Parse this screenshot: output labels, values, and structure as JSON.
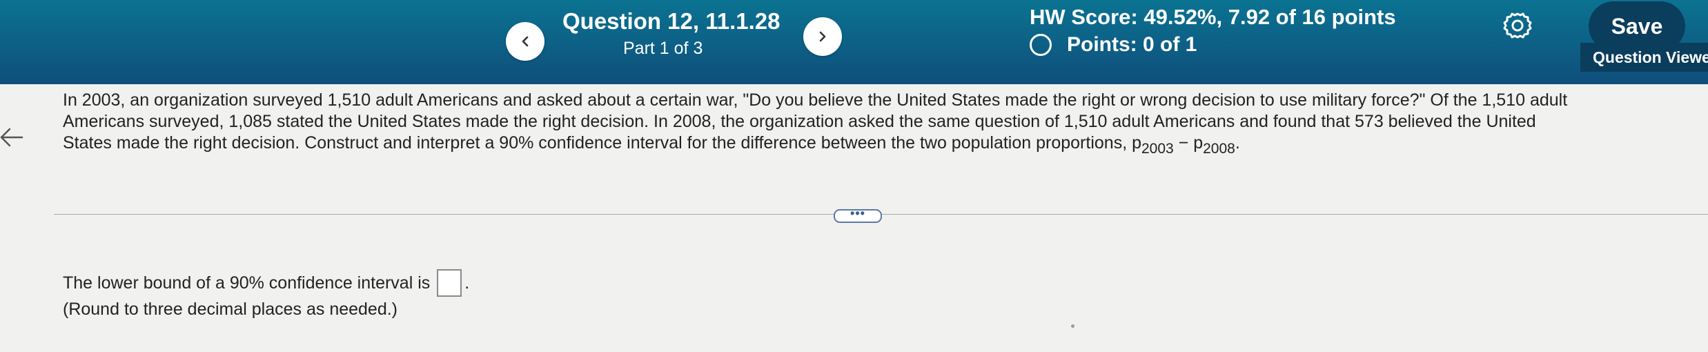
{
  "header": {
    "question_title": "Question 12, 11.1.28",
    "part": "Part 1 of 3",
    "hw_score": "HW Score: 49.52%, 7.92 of 16 points",
    "points": "Points: 0 of 1",
    "save_label": "Save",
    "question_viewer_label": "Question Viewer",
    "icons": {
      "prev": "chevron-left-icon",
      "next": "chevron-right-icon",
      "settings": "gear-icon",
      "points_status": "empty-circle-icon"
    },
    "colors": {
      "header_top": "#0b7391",
      "header_bottom": "#0f4e7c",
      "save_button": "#0b3d5c"
    }
  },
  "question": {
    "line1": "In 2003, an organization surveyed 1,510 adult Americans and asked about a certain war, \"Do you believe the United States made the right or wrong decision to use military force?\" Of the 1,510 adult",
    "line2": "Americans surveyed, 1,085 stated the United States made the right decision. In 2008, the organization asked the same question of 1,510 adult Americans and found that 573 believed the United",
    "line3": "States made the right decision. Construct and interpret a 90% confidence interval for the difference between the two population proportions, ",
    "p": "p",
    "sub1": "2003",
    "minus": " − ",
    "sub2": "2008",
    "end": "."
  },
  "more_label": "•••",
  "answer": {
    "prompt": "The lower bound of a 90% confidence interval is",
    "value": "",
    "suffix": ".",
    "note": "(Round to three decimal places as needed.)"
  }
}
